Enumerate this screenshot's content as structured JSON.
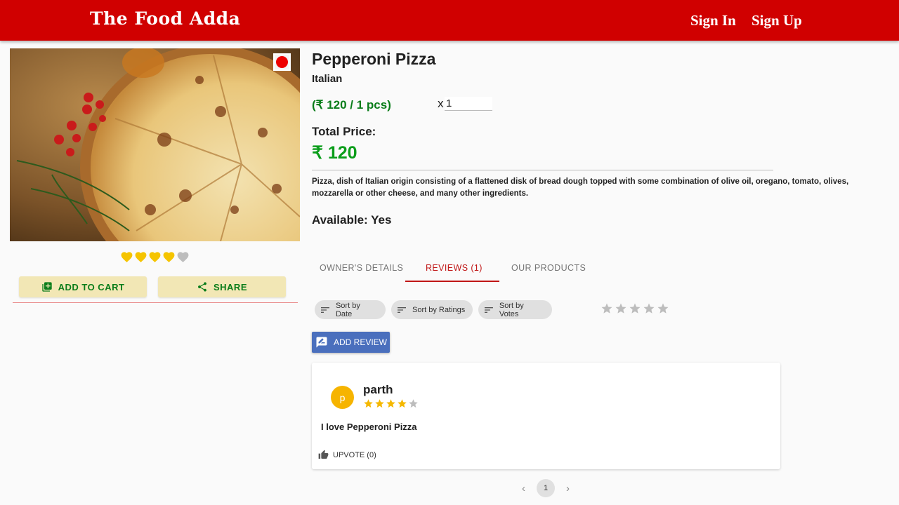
{
  "header": {
    "brand": "The Food Adda",
    "sign_in": "Sign In",
    "sign_up": "Sign Up",
    "bg_color": "#d00000"
  },
  "product": {
    "name": "Pepperoni Pizza",
    "cuisine": "Italian",
    "unit_price": "(₹ 120 / 1 pcs)",
    "quantity_prefix": "x",
    "quantity_value": "1",
    "total_label": "Total Price:",
    "total_value": "₹ 120",
    "description": "Pizza, dish of Italian origin consisting of a flattened disk of bread dough topped with some combination of olive oil, oregano, tomato, olives, mozzarella or other cheese, and many other ingredients.",
    "availability": "Available: Yes",
    "rating_hearts": 4,
    "rating_max": 5,
    "badge": "red-dot-icon"
  },
  "actions": {
    "add_to_cart": "ADD TO CART",
    "share": "SHARE"
  },
  "tabs": [
    {
      "label": "OWNER'S DETAILS",
      "active": false
    },
    {
      "label": "REVIEWS (1)",
      "active": true
    },
    {
      "label": "OUR PRODUCTS",
      "active": false
    }
  ],
  "sort_chips": {
    "date": "Sort by Date",
    "ratings": "Sort by Ratings",
    "votes": "Sort by Votes"
  },
  "filter_stars": {
    "value": 0,
    "max": 5
  },
  "add_review": "ADD REVIEW",
  "reviews": [
    {
      "avatar_letter": "p",
      "name": "parth",
      "rating": 4,
      "max": 5,
      "text": "I love Pepperoni Pizza",
      "upvote": "UPVOTE (0)"
    }
  ],
  "pagination": {
    "current": "1"
  },
  "colors": {
    "accent_red": "#c01616",
    "green": "#0a7d1a",
    "heart": "#f5c400",
    "star": "#f5b800",
    "avatar": "#f6b400",
    "button_blue": "#4a6fbd"
  }
}
